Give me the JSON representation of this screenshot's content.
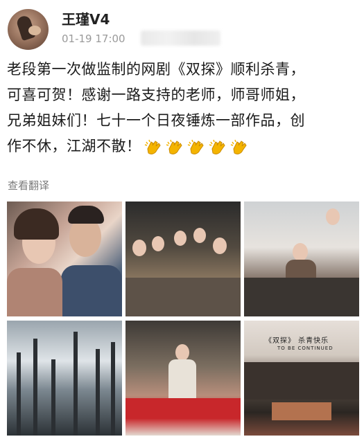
{
  "user": {
    "name": "王瑾V4",
    "timestamp": "01-19 17:00"
  },
  "post": {
    "lines": [
      "老段第一次做监制的网剧《双探》顺利杀青，",
      "可喜可贺！感谢一路支持的老师，师哥师姐，",
      "兄弟姐妹们！七十一个日夜锤炼一部作品，创",
      "作不休，江湖不散！"
    ],
    "emoji": [
      "clapping-hands",
      "clapping-hands",
      "clapping-hands",
      "clapping-hands",
      "clapping-hands"
    ],
    "translate_label": "查看翻译"
  },
  "photos": [
    {
      "id": 1,
      "desc": "selfie"
    },
    {
      "id": 2,
      "desc": "group dinner"
    },
    {
      "id": 3,
      "desc": "makeup room"
    },
    {
      "id": 4,
      "desc": "snowy forest poster"
    },
    {
      "id": 5,
      "desc": "performer on stage"
    },
    {
      "id": 6,
      "desc": "group photo",
      "caption_top": "《双探》 杀青快乐",
      "caption_sub": "TO BE CONTINUED"
    }
  ],
  "colors": {
    "username": "#222222",
    "timestamp": "#9a9a9a",
    "text": "#1a1a1a",
    "translate": "#7a7a7a",
    "emoji": "#f4b400"
  }
}
